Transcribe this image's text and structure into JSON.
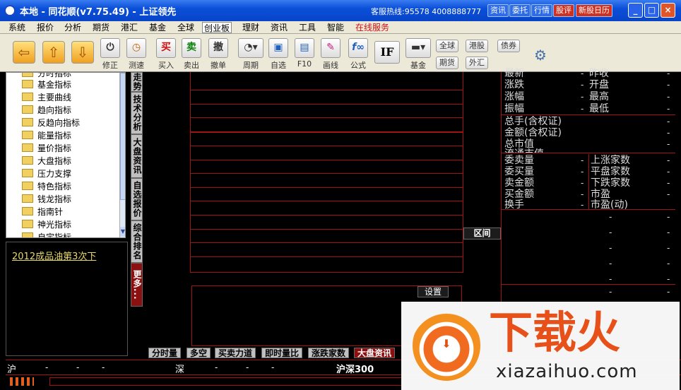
{
  "window": {
    "title": "本地 - 同花顺(v7.75.49) - 上证领先",
    "hotline": "客服热线:95578 4008888777",
    "top_buttons": [
      "资讯",
      "委托",
      "行情",
      "股评",
      "新股日历"
    ],
    "min": "_",
    "max": "□",
    "close": "×"
  },
  "menu": [
    "系统",
    "报价",
    "分析",
    "期货",
    "港汇",
    "基金",
    "全球",
    "创业板",
    "理财",
    "资讯",
    "工具",
    "智能",
    "在线服务"
  ],
  "toolbar": {
    "tools": [
      "修正",
      "测速",
      "买入",
      "卖出",
      "撤单",
      "周期",
      "自选",
      "F10",
      "画线",
      "公式",
      "基金"
    ],
    "icons": {
      "buy": "买",
      "sell": "卖",
      "cancel": "撤",
      "if": "IF"
    },
    "small_buttons": [
      "全球",
      "港股",
      "债券",
      "期货",
      "外汇"
    ]
  },
  "tree": {
    "items": [
      "分时指标",
      "基金指标",
      "主要曲线",
      "趋向指标",
      "反趋向指标",
      "能量指标",
      "量价指标",
      "大盘指标",
      "压力支撑",
      "特色指标",
      "钱龙指标",
      "指南针",
      "神光指标",
      "自定指标"
    ]
  },
  "news": {
    "headline": "2012成品油第3次下"
  },
  "vtabs": [
    "走势",
    "技术分析",
    "大盘资讯",
    "自选报价",
    "综合排名",
    "更多..."
  ],
  "center": {
    "interval_label": "区间",
    "settings_label": "设置"
  },
  "right_panel": {
    "left_labels": [
      "最新",
      "涨跌",
      "涨幅",
      "振幅"
    ],
    "right_labels": [
      "昨收",
      "开盘",
      "最高",
      "最低"
    ],
    "mid_labels": [
      "总手(含权证)",
      "金额(含权证)",
      "总市值",
      "流通市值"
    ],
    "lower_left": [
      "委卖量",
      "委买量",
      "卖金额",
      "买金额",
      "换手"
    ],
    "lower_right": [
      "上涨家数",
      "平盘家数",
      "下跌家数",
      "市盈",
      "市盈(动)"
    ],
    "dash": "-"
  },
  "bottom_tabs": [
    "分时量",
    "多空",
    "买卖力道",
    "即时量比",
    "涨跌家数",
    "大盘资讯"
  ],
  "status": {
    "sh": "沪",
    "sz": "深",
    "hs300": "沪深300",
    "dash": "-"
  },
  "watermark": {
    "brand": "下载火",
    "url": "xiazaihuo.com"
  },
  "colors": {
    "accent_red": "#a01414",
    "title_blue": "#0a4fd8"
  }
}
